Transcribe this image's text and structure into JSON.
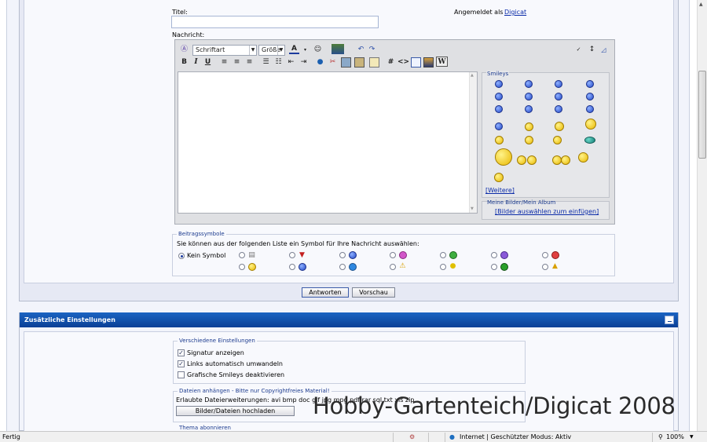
{
  "form": {
    "title_label": "Titel:",
    "title_value": "",
    "logged_in_text": "Angemeldet als",
    "logged_in_user": "Digicat",
    "message_label": "Nachricht:"
  },
  "editor": {
    "font_select": "Schriftart",
    "size_select": "Größe",
    "icons": {
      "row1": [
        "remove-format-icon",
        "font-color-icon",
        "smiley-menu-icon",
        "insert-image-menu-icon",
        "undo-icon",
        "redo-icon",
        "spellcheck-icon",
        "resize-icon",
        "toggle-mode-icon"
      ],
      "row2": [
        "bold-icon",
        "italic-icon",
        "underline-icon",
        "align-left-icon",
        "align-center-icon",
        "align-right-icon",
        "ordered-list-icon",
        "unordered-list-icon",
        "outdent-icon",
        "indent-icon",
        "link-icon",
        "unlink-icon",
        "image-icon",
        "attachment-icon",
        "quote-icon",
        "hash-icon",
        "code-icon",
        "php-icon",
        "picture-icon",
        "wiki-icon"
      ]
    },
    "bold": "B",
    "italic": "I",
    "underline": "U",
    "hash": "#",
    "code": "<>",
    "wiki": "W",
    "smilies_title": "Smileys",
    "smilies_more": "[Weitere]",
    "album_title": "Meine Bilder/Mein Album",
    "album_link": "[Bilder auswählen zum einfügen]"
  },
  "post_icons": {
    "legend": "Beitragssymbole",
    "description": "Sie können aus der folgenden Liste ein Symbol für Ihre Nachricht auswählen:",
    "none_label": "Kein Symbol",
    "selected": "Kein Symbol",
    "icons": [
      "document-icon",
      "thumbs-down-icon",
      "smile-icon",
      "grin-icon",
      "mad-icon",
      "confused-icon",
      "angry-icon",
      "smile-icon",
      "cool-icon",
      "question-icon",
      "warning-icon",
      "lightbulb-icon",
      "arrow-icon",
      "thumbs-up-icon"
    ]
  },
  "buttons": {
    "submit": "Antworten",
    "preview": "Vorschau"
  },
  "extra_settings": {
    "title": "Zusätzliche Einstellungen",
    "misc_legend": "Verschiedene Einstellungen",
    "options": [
      {
        "label": "Signatur anzeigen",
        "checked": true
      },
      {
        "label": "Links automatisch umwandeln",
        "checked": true
      },
      {
        "label": "Grafische Smileys deaktivieren",
        "checked": false
      }
    ],
    "attach_legend": "Dateien anhängen - Bitte nur Copyrightfreies Material!",
    "allowed_ext": "Erlaubte Dateierweiterungen: avi bmp doc gif jpg mpg pdf rar sql txt xls zip",
    "upload_button": "Bilder/Dateien hochladen",
    "subscribe_legend": "Thema abonnieren"
  },
  "watermark": "Hobby-Gartenteich/Digicat 2008",
  "status_bar": {
    "left": "Fertig",
    "zone": "Internet | Geschützter Modus: Aktiv",
    "zoom": "100%"
  }
}
